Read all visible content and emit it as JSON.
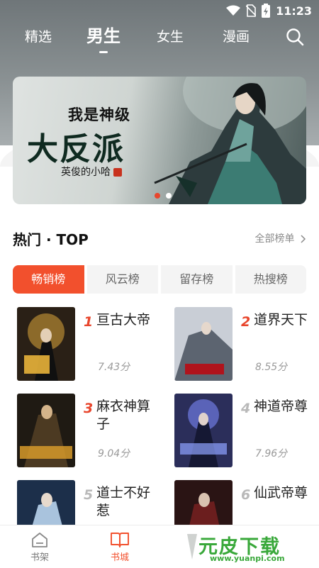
{
  "status_bar": {
    "time": "11:23"
  },
  "top_nav": {
    "tabs": [
      {
        "label": "精选"
      },
      {
        "label": "男生"
      },
      {
        "label": "女生"
      },
      {
        "label": "漫画"
      }
    ],
    "active_tab": "男生"
  },
  "banner": {
    "subtitle": "我是神级",
    "title": "大反派",
    "author": "英俊的小哈",
    "page_count": 2,
    "current_page": 1
  },
  "hot_section": {
    "title": "热门 · TOP",
    "more_label": "全部榜单",
    "rank_tabs": [
      {
        "label": "畅销榜"
      },
      {
        "label": "风云榜"
      },
      {
        "label": "留存榜"
      },
      {
        "label": "热搜榜"
      }
    ],
    "active_rank_tab": "畅销榜",
    "books": [
      {
        "rank": "1",
        "name": "亘古大帝",
        "score": "7.43分"
      },
      {
        "rank": "2",
        "name": "道界天下",
        "score": "8.55分"
      },
      {
        "rank": "3",
        "name": "麻衣神算子",
        "score": "9.04分"
      },
      {
        "rank": "4",
        "name": "神道帝尊",
        "score": "7.96分"
      },
      {
        "rank": "5",
        "name": "道士不好惹",
        "score": ""
      },
      {
        "rank": "6",
        "name": "仙武帝尊",
        "score": ""
      }
    ]
  },
  "bottom_nav": {
    "items": [
      {
        "label": "书架"
      },
      {
        "label": "书城"
      }
    ],
    "active": "书城"
  },
  "watermark": {
    "text": "元皮下载",
    "url": "www.yuanpi.com"
  },
  "colors": {
    "accent": "#f2502d",
    "rank_top": "#e8462d",
    "rank_other": "#b9b9b9",
    "watermark": "#39a83a"
  }
}
